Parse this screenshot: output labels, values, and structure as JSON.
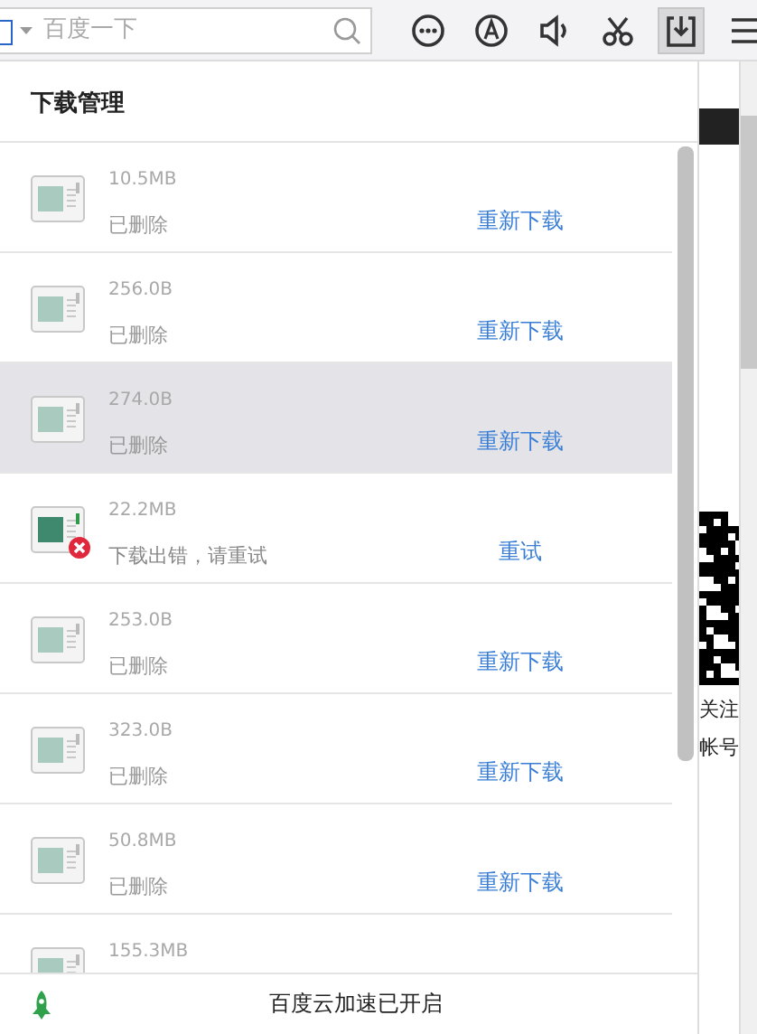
{
  "search": {
    "placeholder": "百度一下"
  },
  "toolbar": [
    {
      "kind": "chat",
      "selected": false
    },
    {
      "kind": "font",
      "selected": false
    },
    {
      "kind": "sound",
      "selected": false
    },
    {
      "kind": "cut",
      "selected": false
    },
    {
      "kind": "download",
      "selected": true
    },
    {
      "kind": "menu",
      "selected": false
    }
  ],
  "panel": {
    "title": "下载管理",
    "downloads": [
      {
        "kind": "deleted",
        "size": "10.5MB",
        "status": "已删除",
        "action": "重新下载",
        "highlighted": false
      },
      {
        "kind": "deleted",
        "size": "256.0B",
        "status": "已删除",
        "action": "重新下载",
        "highlighted": false
      },
      {
        "kind": "deleted",
        "size": "274.0B",
        "status": "已删除",
        "action": "重新下载",
        "highlighted": true
      },
      {
        "kind": "error",
        "size": "22.2MB",
        "status": "下载出错，请重试",
        "action": "重试",
        "highlighted": false
      },
      {
        "kind": "deleted",
        "size": "253.0B",
        "status": "已删除",
        "action": "重新下载",
        "highlighted": false
      },
      {
        "kind": "deleted",
        "size": "323.0B",
        "status": "已删除",
        "action": "重新下载",
        "highlighted": false
      },
      {
        "kind": "deleted",
        "size": "50.8MB",
        "status": "已删除",
        "action": "重新下载",
        "highlighted": false
      },
      {
        "kind": "deleted",
        "size": "155.3MB",
        "highlighted": false
      }
    ],
    "footer": "百度云加速已开启"
  },
  "page_behind": {
    "texts": [
      "关注",
      "帐号"
    ]
  }
}
